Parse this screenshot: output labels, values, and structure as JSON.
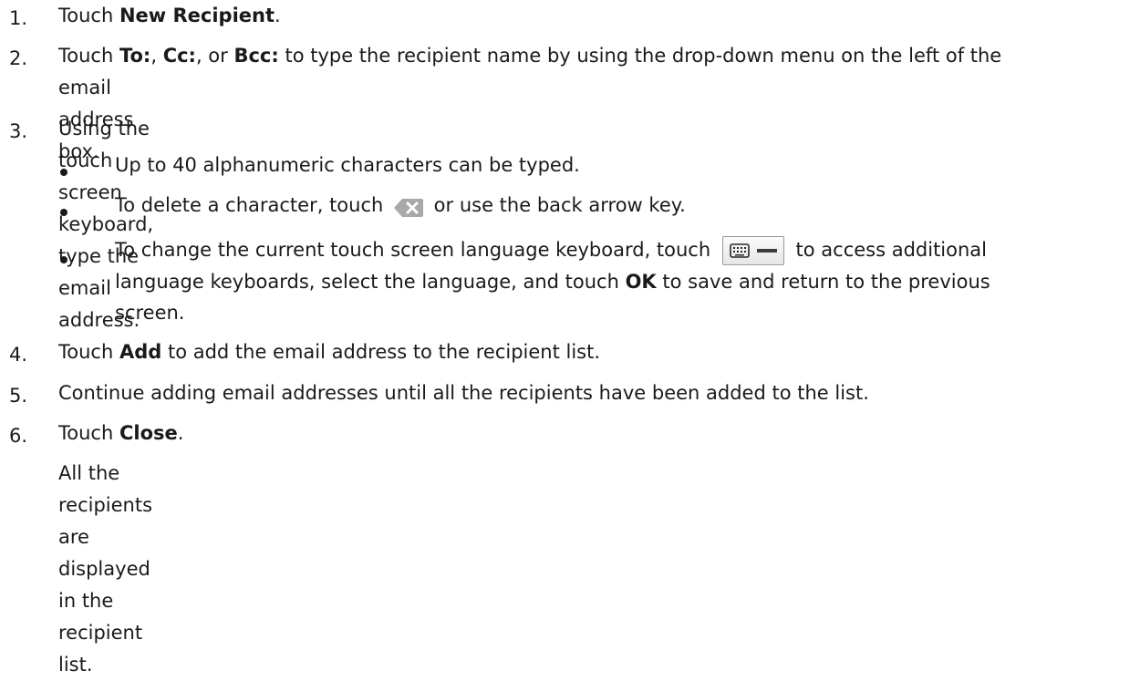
{
  "steps": [
    {
      "num": "1.",
      "pre": "Touch ",
      "b1": "New Recipient",
      "post": "."
    },
    {
      "num": "2.",
      "pre": "Touch ",
      "b1": "To:",
      "m1": ", ",
      "b2": "Cc:",
      "m2": ", or ",
      "b3": "Bcc:",
      "line1_rest": " to type the recipient name by using the drop-down menu on the left of the",
      "line2": "email address box."
    },
    {
      "num": "3.",
      "text": "Using the touch screen keyboard, type the email address."
    },
    {
      "num": "4.",
      "pre": "Touch ",
      "b1": "Add",
      "post": " to add the email address to the recipient list."
    },
    {
      "num": "5.",
      "text": "Continue adding email addresses until all the recipients have been added to the list."
    },
    {
      "num": "6.",
      "pre": "Touch ",
      "b1": "Close",
      "post": ".",
      "note": "All the recipients are displayed in the recipient list."
    }
  ],
  "bullets": [
    {
      "text": "Up to 40 alphanumeric characters can be typed."
    },
    {
      "pre": "To delete a character, touch ",
      "post": " or use the back arrow key."
    },
    {
      "pre": "To change the current touch screen language keyboard, touch ",
      "post": " to access additional",
      "line2": "language keyboards, select the language, and touch ",
      "b1": "OK",
      "line2_post": " to save and return to the previous",
      "line3": "screen."
    }
  ],
  "icons": {
    "delete": "backspace-icon",
    "keyboard": "keyboard-language-icon"
  }
}
